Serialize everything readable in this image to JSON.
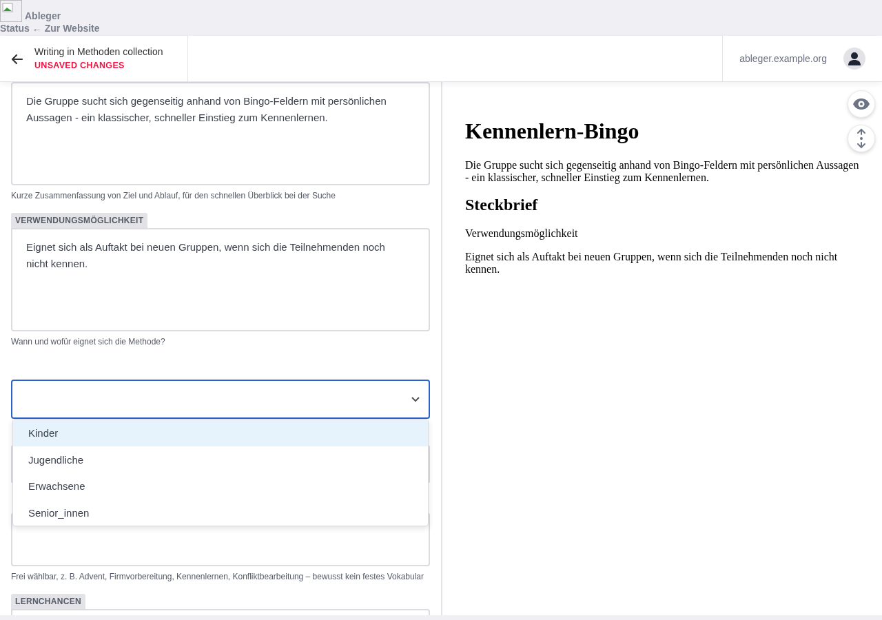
{
  "admin_bar": {
    "site_name": "Ableger",
    "links": [
      "Status",
      "← Zur Website"
    ]
  },
  "header": {
    "title": "Writing in Methoden collection",
    "status": "UNSAVED CHANGES",
    "site": "ableger.example.org"
  },
  "editor": {
    "fields": [
      {
        "kind": "textarea",
        "value": "Die Gruppe sucht sich gegenseitig anhand von Bingo-Feldern mit persönlichen Aussagen - ein klassischer, schneller Einstieg zum Kennenlernen.",
        "help": "Kurze Zusammenfassung von Ziel und Ablauf, für den schnellen Überblick bei der Suche"
      },
      {
        "kind": "textarea",
        "label": "VERWENDUNGSMÖGLICHKEIT",
        "value": "Eignet sich als Auftakt bei neuen Gruppen, wenn sich die Teilnehmenden noch nicht kennen.",
        "help": "Wann und wofür eignet sich die Methode?"
      },
      {
        "kind": "select",
        "expanded": true,
        "options": [
          {
            "label": "Kinder",
            "selected": true
          },
          {
            "label": "Jugendliche",
            "selected": false
          },
          {
            "label": "Erwachsene",
            "selected": false
          },
          {
            "label": "Senior_innen",
            "selected": false
          }
        ]
      },
      {
        "kind": "input"
      },
      {
        "kind": "textarea",
        "help": "Frei wählbar, z. B. Advent, Firmvorbereitung, Kennenlernen, Konfliktbearbeitung – bewusst kein festes Vokabular"
      },
      {
        "kind": "textarea",
        "label": "LERNCHANCEN"
      }
    ]
  },
  "preview": {
    "title": "Kennenlern-Bingo",
    "summary": "Die Gruppe sucht sich gegenseitig anhand von Bingo-Feldern mit persönlichen Aussagen - ein klassischer, schneller Einstieg zum Kennenlernen.",
    "heading": "Steckbrief",
    "label": "Verwendungsmöglichkeit",
    "text": "Eignet sich als Auftakt bei neuen Gruppen, wenn sich die Teilnehmenden noch nicht kennen."
  }
}
